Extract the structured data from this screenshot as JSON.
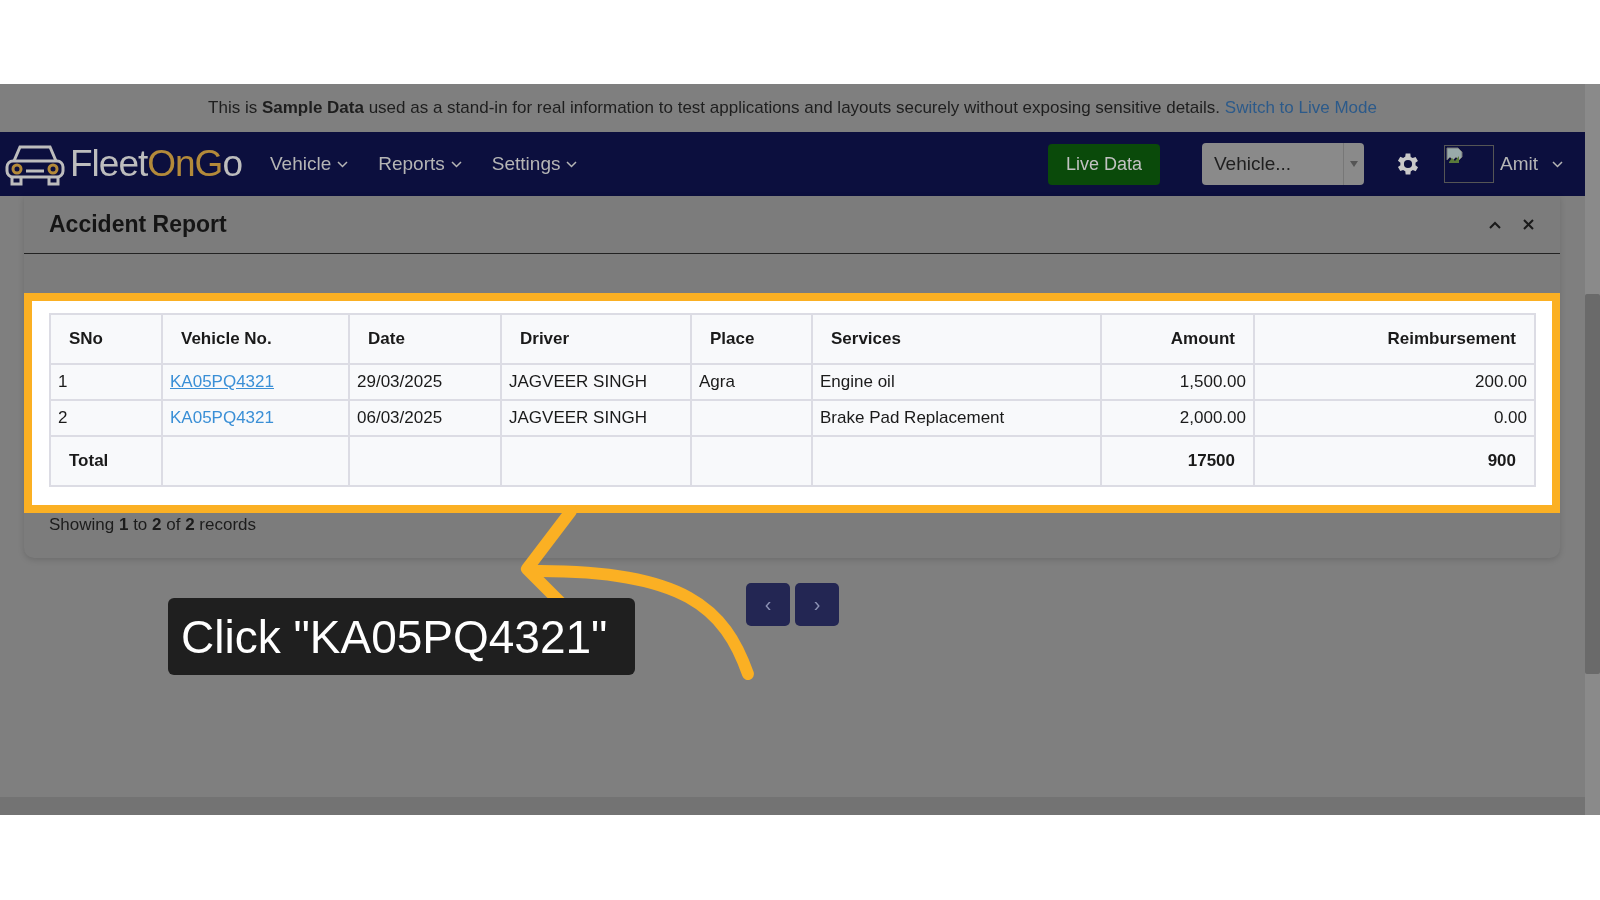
{
  "banner": {
    "text": "This is **Sample Data** used as a stand-in for real information to test applications and layouts securely without exposing sensitive details.",
    "link": "Switch to Live Mode"
  },
  "nav": {
    "logo": [
      {
        "text": "Fleet",
        "accent": false
      },
      {
        "text": "OnG",
        "accent": true
      },
      {
        "text": "o",
        "accent": false
      }
    ],
    "menus": [
      "Vehicle",
      "Reports",
      "Settings"
    ],
    "live_button": "Live Data",
    "vehicle_select": {
      "placeholder": "Vehicle..."
    },
    "user": "Amit"
  },
  "card": {
    "title": "Accident Report",
    "table": {
      "columns": [
        {
          "label": "SNo",
          "kind": "text"
        },
        {
          "label": "Vehicle No.",
          "kind": "link"
        },
        {
          "label": "Date",
          "kind": "text"
        },
        {
          "label": "Driver",
          "kind": "text"
        },
        {
          "label": "Place",
          "kind": "text"
        },
        {
          "label": "Services",
          "kind": "text"
        },
        {
          "label": "Amount",
          "kind": "number"
        },
        {
          "label": "Reimbursement",
          "kind": "number"
        }
      ],
      "rows": [
        {
          "hovered": true,
          "cells": [
            "1",
            "KA05PQ4321",
            "29/03/2025",
            "JAGVEER SINGH",
            "Agra",
            "Engine oil",
            "1,500.00",
            "200.00"
          ]
        },
        {
          "hovered": false,
          "cells": [
            "2",
            "KA05PQ4321",
            "06/03/2025",
            "JAGVEER SINGH",
            null,
            "Brake Pad Replacement",
            "2,000.00",
            "0.00"
          ]
        }
      ],
      "total": {
        "cells": [
          "Total",
          null,
          null,
          null,
          null,
          null,
          "17500",
          "900"
        ]
      }
    },
    "footer": "Showing **1** to **2** of **2** records"
  },
  "pagination": [
    "‹",
    "›"
  ],
  "tutorial": {
    "callout": "Click \"KA05PQ4321\""
  }
}
